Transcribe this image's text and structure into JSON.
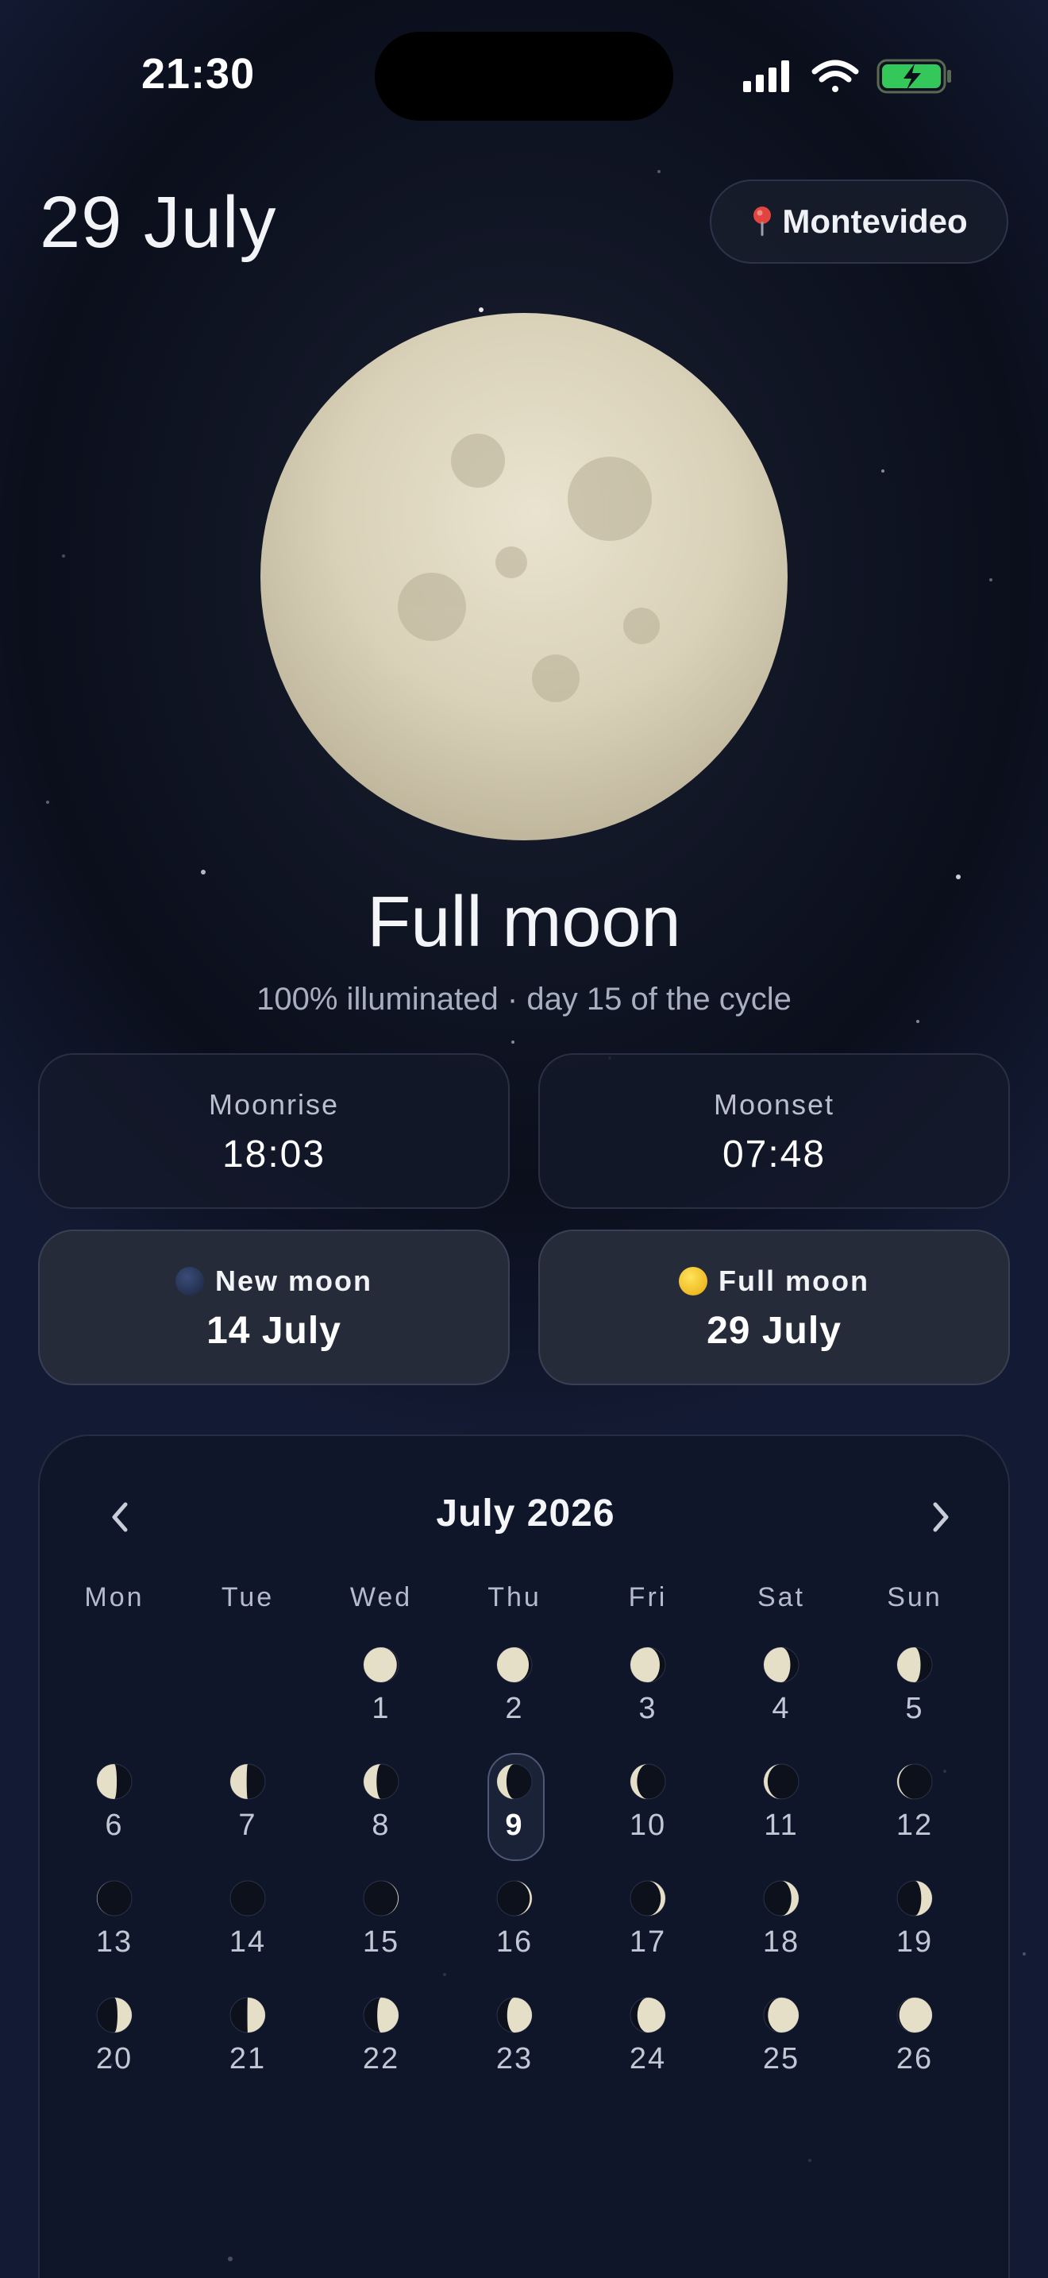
{
  "status_bar": {
    "time": "21:30",
    "icons": [
      "cellular-signal-icon",
      "wifi-icon",
      "battery-charging-icon"
    ],
    "battery_color": "#34c759"
  },
  "header": {
    "date": "29 July",
    "location": "Montevideo",
    "location_icon": "pin-icon"
  },
  "moon": {
    "phase_name": "Full moon",
    "subtitle": "100% illuminated · day 15 of the cycle",
    "illumination": 1.0
  },
  "times": [
    {
      "label": "Moonrise",
      "value": "18:03"
    },
    {
      "label": "Moonset",
      "value": "07:48"
    }
  ],
  "next_phases": [
    {
      "label": "New moon",
      "value": "14 July",
      "icon": "new-moon-dot-icon",
      "color": "#243457"
    },
    {
      "label": "Full moon",
      "value": "29 July",
      "icon": "full-moon-dot-icon",
      "color": "#f4c320"
    }
  ],
  "calendar": {
    "month_label": "July 2026",
    "prev_icon": "chevron-left-icon",
    "next_icon": "chevron-right-icon",
    "weekdays": [
      "Mon",
      "Tue",
      "Wed",
      "Thu",
      "Fri",
      "Sat",
      "Sun"
    ],
    "first_weekday_index": 2,
    "selected_day": 9,
    "days": [
      {
        "day": "1",
        "phase": 0.95,
        "waxing": false
      },
      {
        "day": "2",
        "phase": 0.91,
        "waxing": false
      },
      {
        "day": "3",
        "phase": 0.84,
        "waxing": false
      },
      {
        "day": "4",
        "phase": 0.76,
        "waxing": false
      },
      {
        "day": "5",
        "phase": 0.67,
        "waxing": false
      },
      {
        "day": "6",
        "phase": 0.57,
        "waxing": false
      },
      {
        "day": "7",
        "phase": 0.47,
        "waxing": false
      },
      {
        "day": "8",
        "phase": 0.37,
        "waxing": false
      },
      {
        "day": "9",
        "phase": 0.27,
        "waxing": false
      },
      {
        "day": "10",
        "phase": 0.19,
        "waxing": false
      },
      {
        "day": "11",
        "phase": 0.11,
        "waxing": false
      },
      {
        "day": "12",
        "phase": 0.05,
        "waxing": false
      },
      {
        "day": "13",
        "phase": 0.01,
        "waxing": false
      },
      {
        "day": "14",
        "phase": 0.0,
        "waxing": true
      },
      {
        "day": "15",
        "phase": 0.02,
        "waxing": true
      },
      {
        "day": "16",
        "phase": 0.06,
        "waxing": true
      },
      {
        "day": "17",
        "phase": 0.13,
        "waxing": true
      },
      {
        "day": "18",
        "phase": 0.21,
        "waxing": true
      },
      {
        "day": "19",
        "phase": 0.31,
        "waxing": true
      },
      {
        "day": "20",
        "phase": 0.41,
        "waxing": true
      },
      {
        "day": "21",
        "phase": 0.51,
        "waxing": true
      },
      {
        "day": "22",
        "phase": 0.61,
        "waxing": true
      },
      {
        "day": "23",
        "phase": 0.71,
        "waxing": true
      },
      {
        "day": "24",
        "phase": 0.8,
        "waxing": true
      },
      {
        "day": "25",
        "phase": 0.88,
        "waxing": true
      },
      {
        "day": "26",
        "phase": 0.94,
        "waxing": true
      }
    ]
  },
  "colors": {
    "moon_light": "#e6dfc8",
    "moon_dark": "#0d111c",
    "accent_border": "#4c5876"
  }
}
